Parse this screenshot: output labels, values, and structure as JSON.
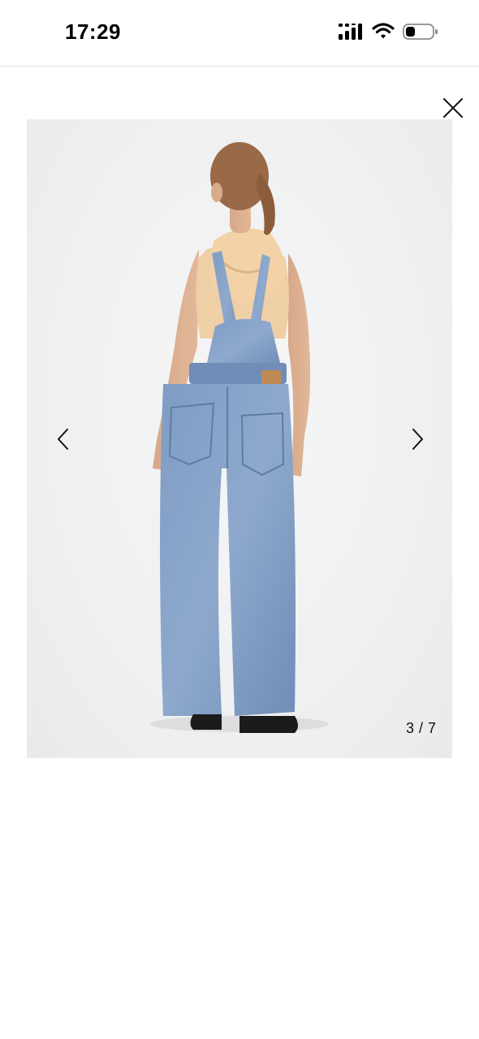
{
  "status_bar": {
    "time": "17:29",
    "icons": [
      "signal-icon",
      "wifi-icon",
      "battery-icon"
    ]
  },
  "gallery": {
    "close_icon": "close-icon",
    "prev_icon": "chevron-left-icon",
    "next_icon": "chevron-right-icon",
    "counter": "3 / 7",
    "current_index": 3,
    "total": 7,
    "image_subject": "model-in-denim-overalls-back-view"
  },
  "colors": {
    "background": "#ffffff",
    "photo_background": "#eeeff0",
    "icon": "#111111"
  }
}
